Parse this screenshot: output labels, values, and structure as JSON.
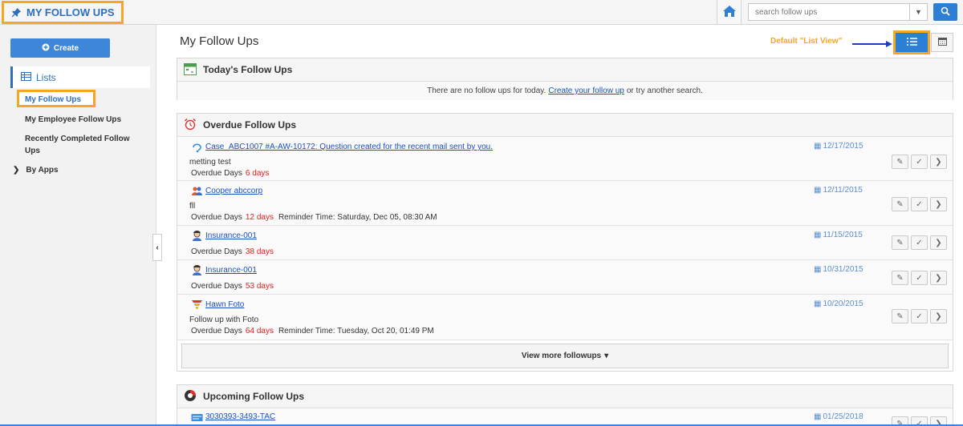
{
  "header": {
    "app_title": "MY FOLLOW UPS",
    "search_placeholder": "search follow ups"
  },
  "sidebar": {
    "create_label": "Create",
    "lists_label": "Lists",
    "items": [
      {
        "label": "My Follow Ups"
      },
      {
        "label": "My Employee Follow Ups"
      },
      {
        "label": "Recently Completed Follow Ups"
      }
    ],
    "by_apps_label": "By Apps"
  },
  "main": {
    "title": "My Follow Ups",
    "annotation": "Default \"List View\""
  },
  "today": {
    "title": "Today's Follow Ups",
    "empty_text_before": "There are no follow ups for today.",
    "create_link": "Create your follow up",
    "empty_text_after": "or try another search."
  },
  "overdue": {
    "title": "Overdue Follow Ups",
    "days_label": "Overdue Days",
    "rows": [
      {
        "name": "Case_ABC1007 #A-AW-10172: Question created for the recent mail sent by you.",
        "date": "12/17/2015",
        "note": "metting test",
        "days": "6 days",
        "reminder": ""
      },
      {
        "name": "Cooper abccorp",
        "date": "12/11/2015",
        "note": "fll",
        "days": "12 days",
        "reminder": "Reminder Time: Saturday, Dec 05, 08:30 AM"
      },
      {
        "name": "Insurance-001",
        "date": "11/15/2015",
        "note": "",
        "days": "38 days",
        "reminder": ""
      },
      {
        "name": "Insurance-001",
        "date": "10/31/2015",
        "note": "",
        "days": "53 days",
        "reminder": ""
      },
      {
        "name": "Hawn Foto",
        "date": "10/20/2015",
        "note": "Follow up with Foto",
        "days": "64 days",
        "reminder": "Reminder Time: Tuesday, Oct 20, 01:49 PM"
      }
    ],
    "view_more_label": "View more followups"
  },
  "upcoming": {
    "title": "Upcoming Follow Ups",
    "rows": [
      {
        "name": "3030393-3493-TAC",
        "date": "01/25/2018"
      }
    ]
  },
  "colors": {
    "accent": "#2c6fbe",
    "highlight": "#f5a623",
    "overdue_red": "#e02020"
  }
}
